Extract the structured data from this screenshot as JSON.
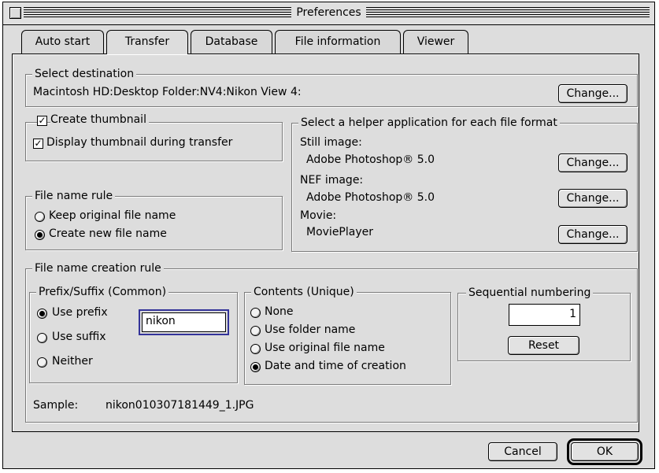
{
  "window": {
    "title": "Preferences"
  },
  "tabs": [
    {
      "label": "Auto start",
      "active": false
    },
    {
      "label": "Transfer",
      "active": true
    },
    {
      "label": "Database",
      "active": false
    },
    {
      "label": "File information",
      "active": false
    },
    {
      "label": "Viewer",
      "active": false
    }
  ],
  "destination": {
    "group_title": "Select destination",
    "path": "Macintosh HD:Desktop Folder:NV4:Nikon View 4:",
    "change_label": "Change..."
  },
  "thumbnail": {
    "create_label": "Create thumbnail",
    "create_checked": true,
    "display_label": "Display thumbnail during transfer",
    "display_checked": true
  },
  "helpers": {
    "group_title": "Select a helper application for each file format",
    "still_label": "Still image:",
    "still_app": "Adobe Photoshop® 5.0",
    "nef_label": "NEF image:",
    "nef_app": "Adobe Photoshop® 5.0",
    "movie_label": "Movie:",
    "movie_app": "MoviePlayer",
    "change_label": "Change..."
  },
  "file_name_rule": {
    "group_title": "File name rule",
    "keep_label": "Keep original file name",
    "create_label": "Create new file name",
    "selected": "create"
  },
  "creation_rule": {
    "group_title": "File name creation rule",
    "prefix_group_title": "Prefix/Suffix (Common)",
    "use_prefix_label": "Use prefix",
    "use_suffix_label": "Use suffix",
    "neither_label": "Neither",
    "prefix_selected": "prefix",
    "prefix_value": "nikon",
    "contents_group_title": "Contents (Unique)",
    "none_label": "None",
    "folder_label": "Use folder name",
    "original_label": "Use original file name",
    "datetime_label": "Date and time of creation",
    "contents_selected": "datetime",
    "seq_group_title": "Sequential numbering",
    "seq_value": "1",
    "reset_label": "Reset",
    "sample_label": "Sample:",
    "sample_value": "nikon010307181449_1.JPG"
  },
  "footer": {
    "cancel_label": "Cancel",
    "ok_label": "OK"
  }
}
